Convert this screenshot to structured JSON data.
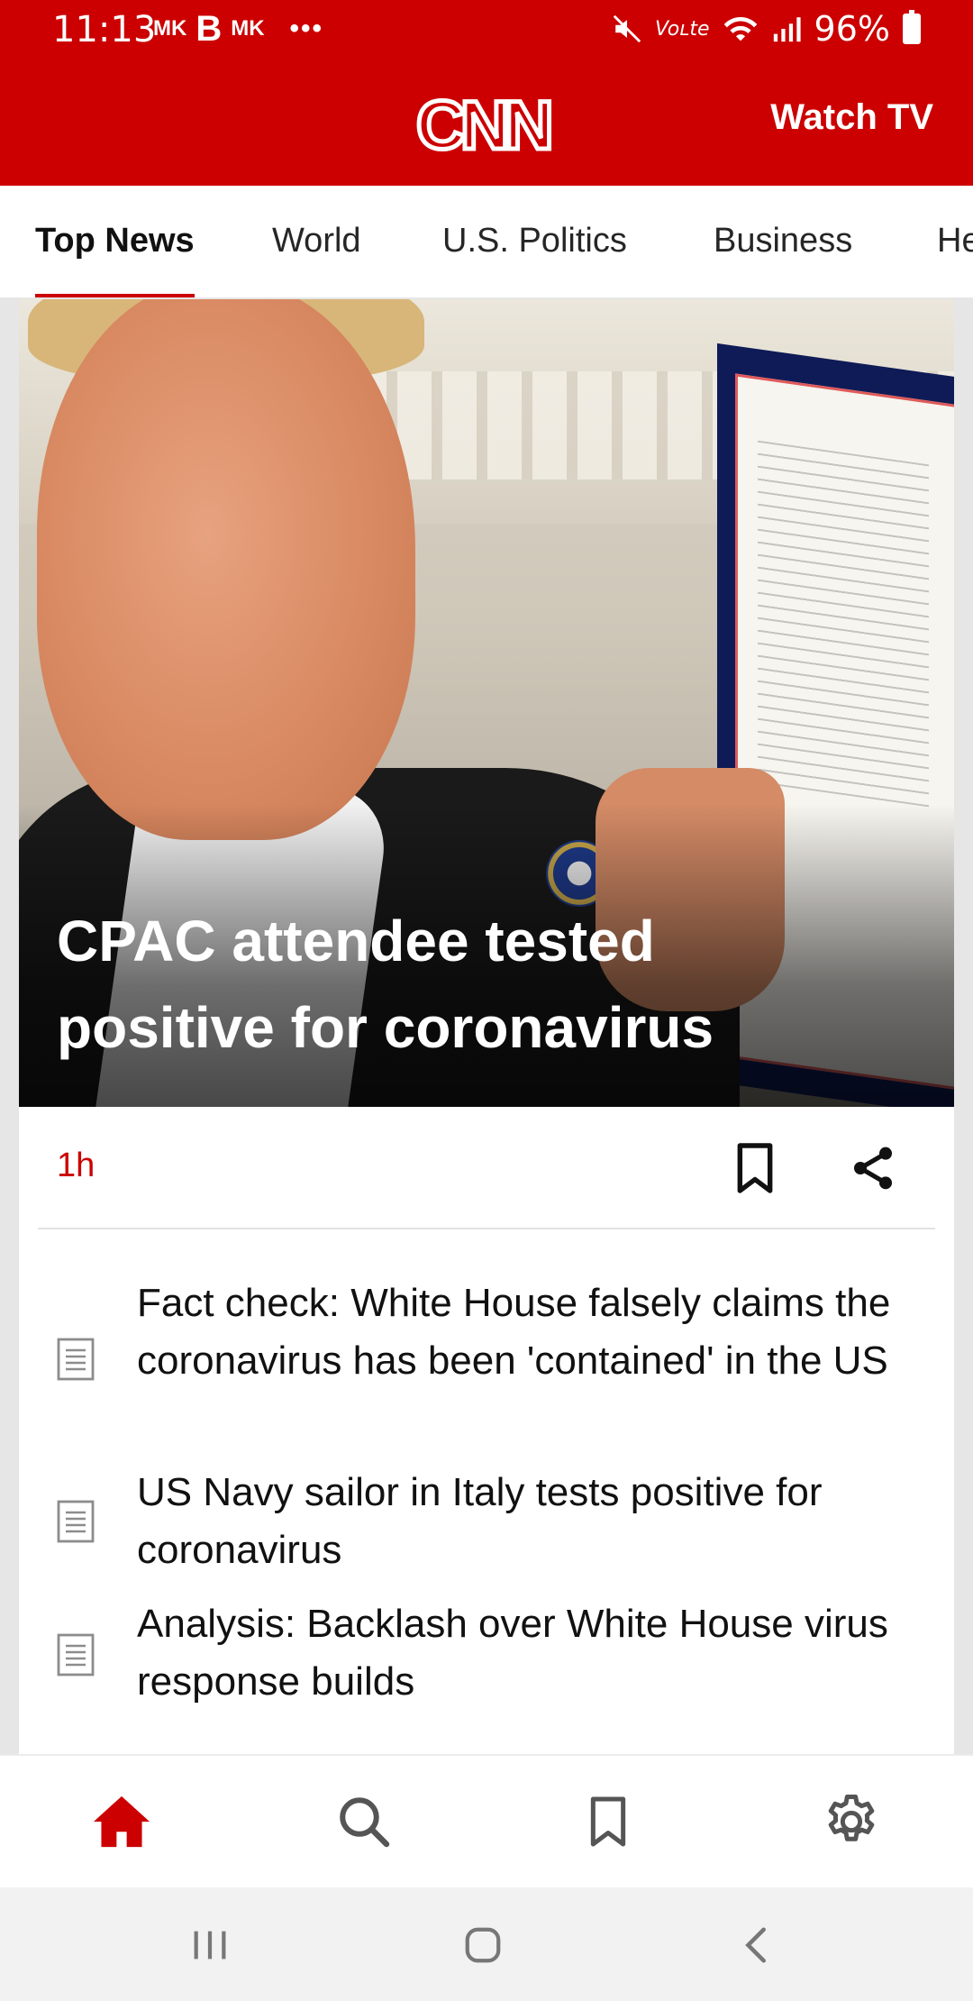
{
  "status_bar": {
    "time": "11:13",
    "left_icons": [
      "MK",
      "B",
      "MK",
      "•••"
    ],
    "right_text_small": "Voʟte",
    "battery": "96%"
  },
  "header": {
    "logo": "CNN",
    "watch_tv": "Watch TV"
  },
  "tabs": [
    {
      "label": "Top News",
      "active": true
    },
    {
      "label": "World"
    },
    {
      "label": "U.S. Politics"
    },
    {
      "label": "Business"
    },
    {
      "label": "He"
    }
  ],
  "hero": {
    "title": "CPAC attendee tested positive for coronavirus",
    "time_ago": "1h"
  },
  "related": [
    {
      "title": "Fact check: White House falsely claims the coronavirus has been 'contained' in the US"
    },
    {
      "title": "US Navy sailor in Italy tests positive for coronavirus"
    },
    {
      "title": "Analysis: Backlash over White House virus response builds"
    }
  ],
  "bottom_nav": [
    "home-icon",
    "search-icon",
    "bookmark-icon",
    "settings-icon"
  ],
  "colors": {
    "brand_red": "#cc0000",
    "text_dark": "#111111",
    "icon_gray": "#555555"
  }
}
